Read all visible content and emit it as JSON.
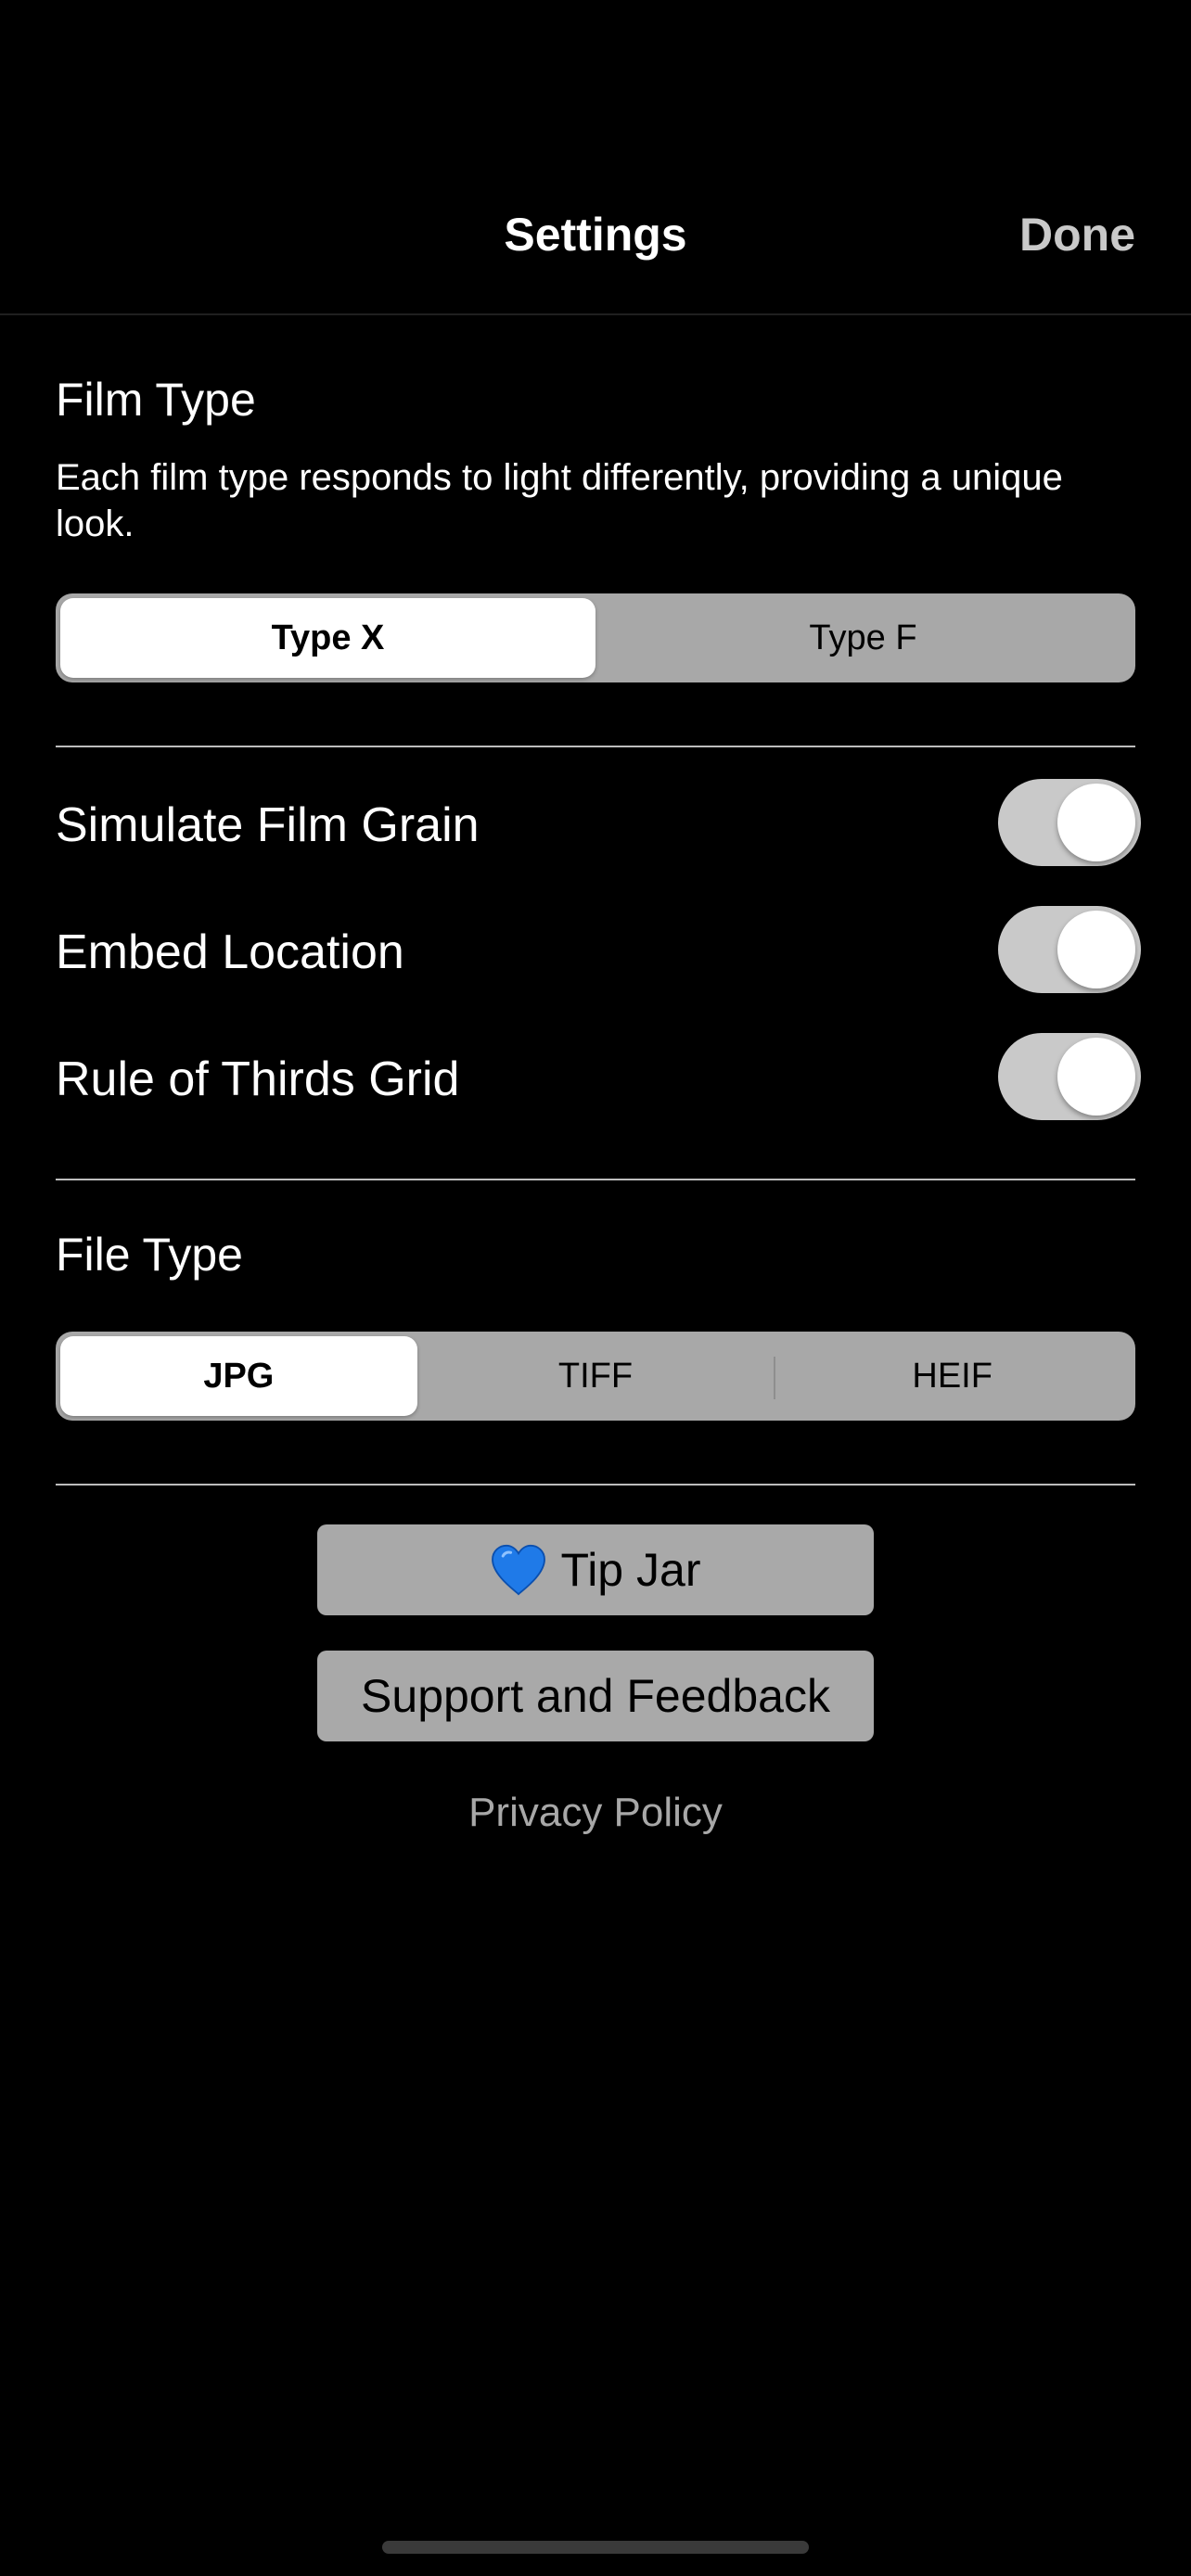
{
  "nav": {
    "title": "Settings",
    "done_label": "Done"
  },
  "film_type": {
    "title": "Film Type",
    "description": "Each film type responds to light differently, providing a unique look.",
    "options": [
      "Type X",
      "Type F"
    ],
    "selected": "Type X"
  },
  "toggles": [
    {
      "label": "Simulate Film Grain",
      "on": true
    },
    {
      "label": "Embed Location",
      "on": true
    },
    {
      "label": "Rule of Thirds Grid",
      "on": true
    }
  ],
  "file_type": {
    "title": "File Type",
    "options": [
      "JPG",
      "TIFF",
      "HEIF"
    ],
    "selected": "JPG"
  },
  "buttons": {
    "tip_jar_label": "Tip Jar",
    "tip_jar_icon": "blue-heart-icon",
    "support_label": "Support and Feedback"
  },
  "privacy_label": "Privacy Policy",
  "colors": {
    "background": "#000000",
    "control_fill": "#a8a8a8",
    "toggle_track": "#c9c9c9",
    "heart": "#1f7ae8"
  }
}
